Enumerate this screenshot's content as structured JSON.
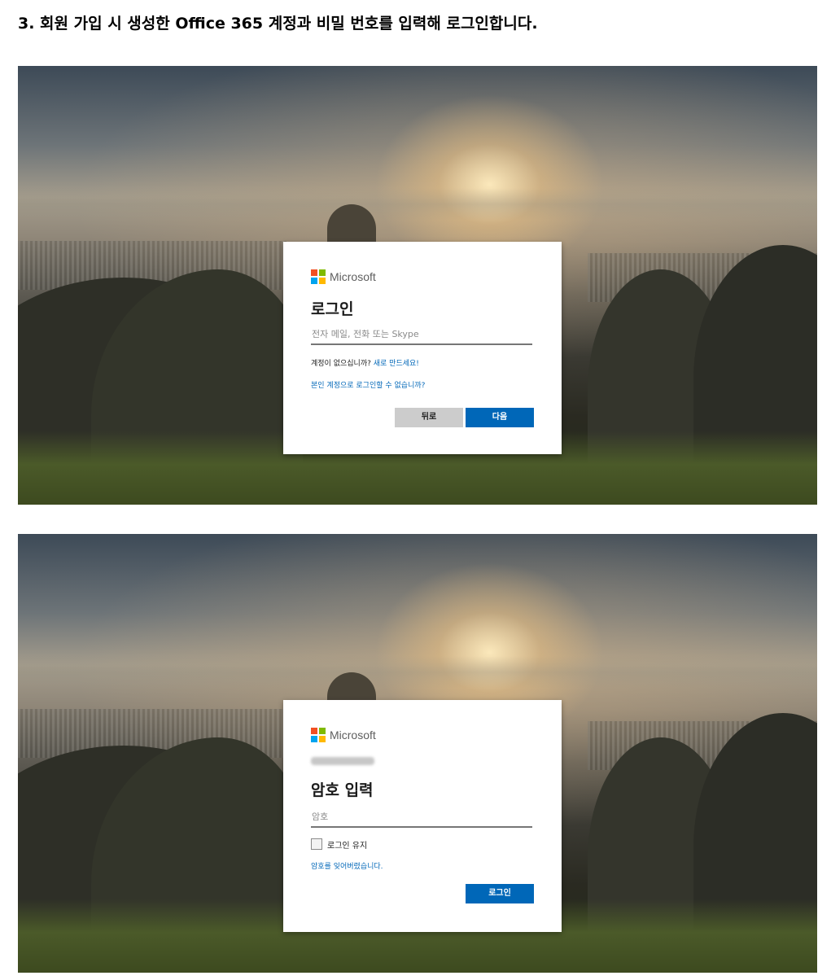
{
  "document": {
    "heading": "3. 회원 가입 시 생성한 Office 365 계정과 비밀 번호를 입력해 로그인합니다."
  },
  "colors": {
    "accent_blue": "#0067b8",
    "button_gray": "#cccccc",
    "ms_red": "#f25022",
    "ms_green": "#7fba00",
    "ms_blue": "#00a4ef",
    "ms_yellow": "#ffb900"
  },
  "screen1": {
    "brand": "Microsoft",
    "title": "로그인",
    "input_placeholder": "전자 메일, 전화 또는 Skype",
    "no_account_text": "계정이 없으십니까?",
    "create_link": "새로 만드세요!",
    "cant_access_link": "본인 계정으로 로그인할 수 없습니까?",
    "back_button": "뒤로",
    "next_button": "다음",
    "logo_icon": "microsoft-logo-icon"
  },
  "screen2": {
    "brand": "Microsoft",
    "account_email": "test@com.com",
    "title": "암호 입력",
    "input_placeholder": "암호",
    "keep_signed_in": "로그인 유지",
    "forgot_link": "암호를 잊어버렸습니다.",
    "signin_button": "로그인",
    "logo_icon": "microsoft-logo-icon"
  }
}
